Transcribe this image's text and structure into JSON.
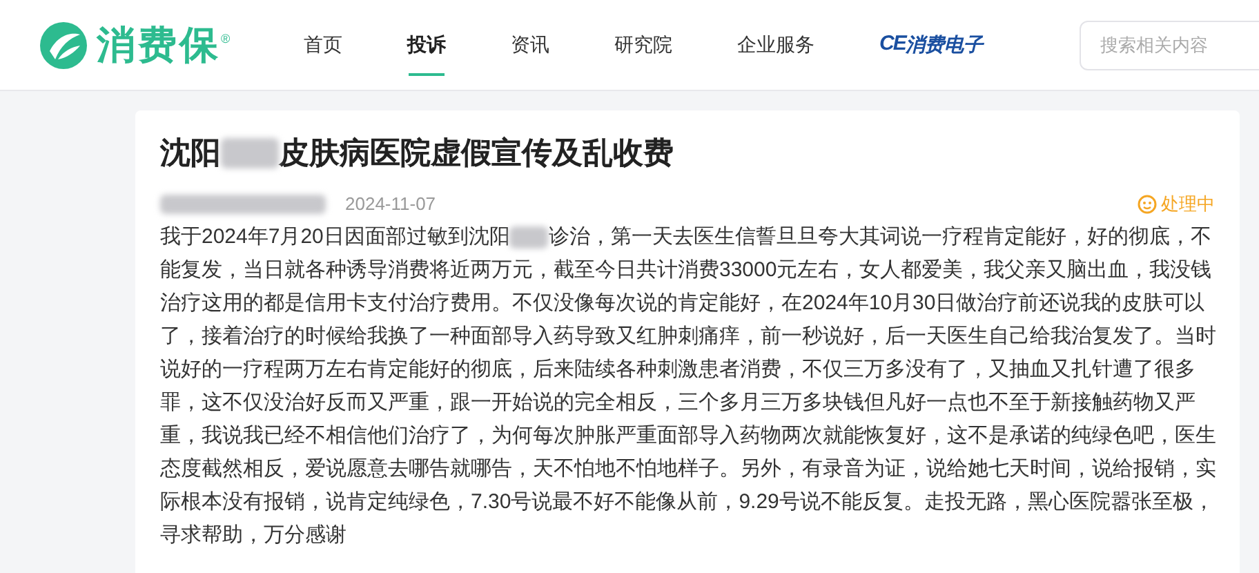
{
  "header": {
    "logo": {
      "text": "消费保",
      "mark": "®"
    },
    "nav": [
      {
        "label": "首页",
        "selected": false
      },
      {
        "label": "投诉",
        "selected": true
      },
      {
        "label": "资讯",
        "selected": false
      },
      {
        "label": "研究院",
        "selected": false
      },
      {
        "label": "企业服务",
        "selected": false
      }
    ],
    "partner": {
      "badge": "CE",
      "text": "消费电子"
    },
    "search": {
      "placeholder": "搜索相关内容"
    }
  },
  "complaint": {
    "title_before": "沈阳",
    "title_after": "皮肤病医院虚假宣传及乱收费",
    "date": "2024-11-07",
    "status": "处理中",
    "body_before": "我于2024年7月20日因面部过敏到沈阳",
    "body_after": "诊治，第一天去医生信誓旦旦夸大其词说一疗程肯定能好，好的彻底，不能复发，当日就各种诱导消费将近两万元，截至今日共计消费33000元左右，女人都爱美，我父亲又脑出血，我没钱治疗这用的都是信用卡支付治疗费用。不仅没像每次说的肯定能好，在2024年10月30日做治疗前还说我的皮肤可以了，接着治疗的时候给我换了一种面部导入药导致又红肿刺痛痒，前一秒说好，后一天医生自己给我治复发了。当时说好的一疗程两万左右肯定能好的彻底，后来陆续各种刺激患者消费，不仅三万多没有了，又抽血又扎针遭了很多罪，这不仅没治好反而又严重，跟一开始说的完全相反，三个多月三万多块钱但凡好一点也不至于新接触药物又严重，我说我已经不相信他们治疗了，为何每次肿胀严重面部导入药物两次就能恢复好，这不是承诺的纯绿色吧，医生态度截然相反，爱说愿意去哪告就哪告，天不怕地不怕地样子。另外，有录音为证，说给她七天时间，说给报销，实际根本没有报销，说肯定纯绿色，7.30号说最不好不能像从前，9.29号说不能反复。走投无路，黑心医院嚣张至极，寻求帮助，万分感谢"
  }
}
